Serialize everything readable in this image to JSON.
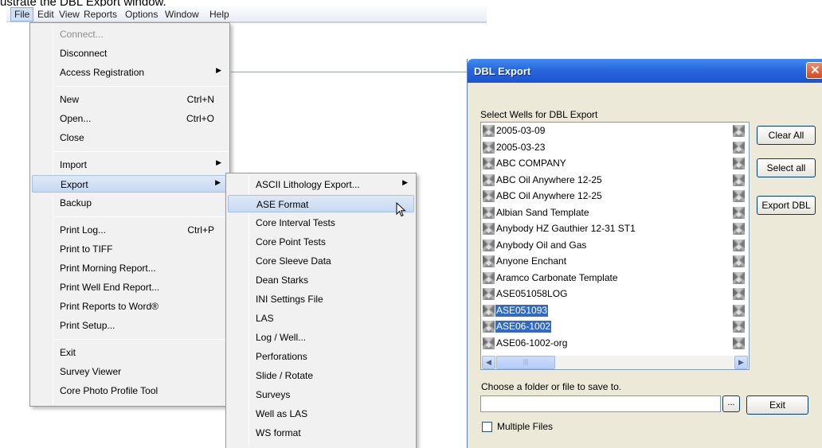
{
  "caption": "ustrate the DBL Export window.",
  "menubar": {
    "items": [
      "File",
      "Edit",
      "View",
      "Reports",
      "Options",
      "Window",
      "Help"
    ]
  },
  "file_menu": {
    "items": [
      {
        "label": "Connect...",
        "disabled": true
      },
      {
        "label": "Disconnect"
      },
      {
        "label": "Access Registration",
        "submenu": true
      },
      {
        "label": "New",
        "shortcut": "Ctrl+N"
      },
      {
        "label": "Open...",
        "shortcut": "Ctrl+O"
      },
      {
        "label": "Close"
      },
      {
        "label": "Import",
        "submenu": true
      },
      {
        "label": "Export",
        "submenu": true,
        "highlighted": true
      },
      {
        "label": "Backup"
      },
      {
        "label": "Print Log...",
        "shortcut": "Ctrl+P"
      },
      {
        "label": "Print to TIFF"
      },
      {
        "label": "Print Morning Report..."
      },
      {
        "label": "Print Well End Report..."
      },
      {
        "label": "Print Reports to Word®"
      },
      {
        "label": "Print Setup..."
      },
      {
        "label": "Exit"
      },
      {
        "label": "Survey Viewer"
      },
      {
        "label": "Core Photo Profile Tool"
      }
    ]
  },
  "export_menu": {
    "items": [
      {
        "label": "ASCII Lithology Export...",
        "submenu": true
      },
      {
        "label": "ASE Format",
        "highlighted": true
      },
      {
        "label": "Core Interval Tests"
      },
      {
        "label": "Core Point Tests"
      },
      {
        "label": "Core Sleeve Data"
      },
      {
        "label": "Dean Starks"
      },
      {
        "label": "INI Settings File"
      },
      {
        "label": "LAS"
      },
      {
        "label": "Log / Well..."
      },
      {
        "label": "Perforations"
      },
      {
        "label": "Slide / Rotate"
      },
      {
        "label": "Surveys"
      },
      {
        "label": "Well as LAS"
      },
      {
        "label": "WS format"
      }
    ]
  },
  "dialog": {
    "title": "DBL Export",
    "select_label": "Select Wells for DBL Export",
    "wells": [
      {
        "name": "2005-03-09"
      },
      {
        "name": "2005-03-23"
      },
      {
        "name": "ABC COMPANY"
      },
      {
        "name": "ABC Oil Anywhere 12-25"
      },
      {
        "name": "ABC Oil Anywhere 12-25"
      },
      {
        "name": "Albian Sand Template"
      },
      {
        "name": "Anybody HZ Gauthier 12-31 ST1"
      },
      {
        "name": "Anybody Oil and Gas"
      },
      {
        "name": "Anyone Enchant"
      },
      {
        "name": "Aramco Carbonate Template"
      },
      {
        "name": "ASE051058LOG"
      },
      {
        "name": "ASE051093",
        "selected": true
      },
      {
        "name": "ASE06-1002",
        "selected": true
      },
      {
        "name": "ASE06-1002-org"
      }
    ],
    "buttons": {
      "clear_all": "Clear All",
      "select_all": "Select all",
      "export_dbl": "Export DBL",
      "exit": "Exit",
      "browse": "..."
    },
    "save_label": "Choose a folder or file to save to.",
    "path_value": "",
    "multiple_files_label": "Multiple Files",
    "multiple_files_checked": false
  },
  "colors": {
    "title_bar": "#2a67db",
    "selection": "#316ac5",
    "menu_highlight": "#c6d9f1",
    "dialog_face": "#ece9d8"
  }
}
